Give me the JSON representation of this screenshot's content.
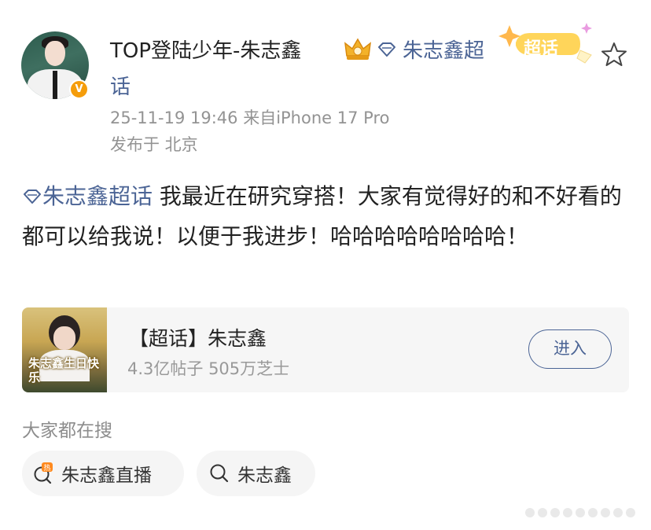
{
  "user": {
    "name": "TOP登陆少年-朱志鑫",
    "topic_tag_line1": "朱志鑫超",
    "topic_tag_line2": "话",
    "badge_text": "超话",
    "verified_mark": "V"
  },
  "meta": {
    "time_source": "25-11-19 19:46  来自iPhone 17 Pro",
    "location": "发布于 北京"
  },
  "post": {
    "topic": "朱志鑫超话",
    "text": " 我最近在研究穿搭！大家有觉得好的和不好看的都可以给我说！以便于我进步！哈哈哈哈哈哈哈哈！"
  },
  "card": {
    "image_caption": "朱志鑫生日快乐",
    "title": "【超话】朱志鑫",
    "stats": "4.3亿帖子 505万芝士",
    "enter_label": "进入"
  },
  "search": {
    "label": "大家都在搜",
    "chips": [
      {
        "label": "朱志鑫直播",
        "icon": "hot-search-icon"
      },
      {
        "label": "朱志鑫",
        "icon": "search-icon"
      }
    ]
  },
  "colors": {
    "link_blue": "#4b6495",
    "meta_gray": "#939393",
    "badge_orange": "#f59d0b",
    "chaohua_yellow": "#ffd55a"
  }
}
